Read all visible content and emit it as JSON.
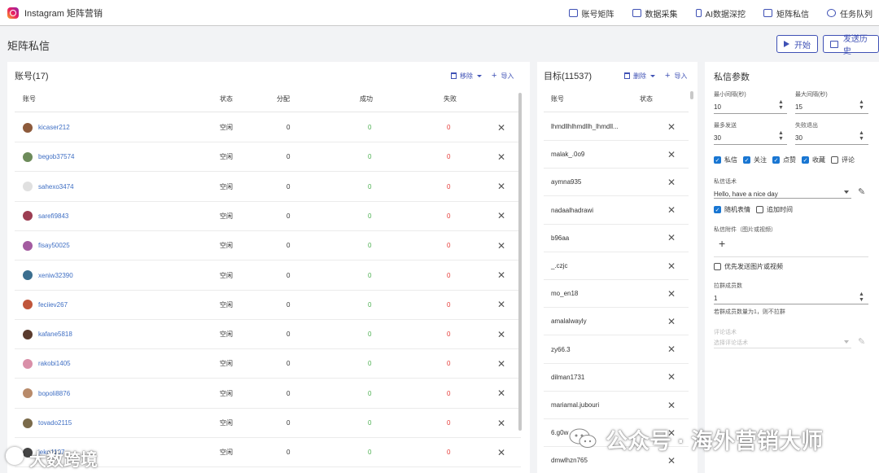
{
  "app": {
    "title": "Instagram 矩阵营销"
  },
  "nav": [
    {
      "label": "账号矩阵",
      "icon": "account-matrix-icon"
    },
    {
      "label": "数据采集",
      "icon": "data-collect-icon"
    },
    {
      "label": "AI数据深挖",
      "icon": "ai-dig-icon"
    },
    {
      "label": "矩阵私信",
      "icon": "dm-icon"
    },
    {
      "label": "任务队列",
      "icon": "task-queue-icon"
    }
  ],
  "page": {
    "title": "矩阵私信",
    "start_label": "开始",
    "history_label": "发送历史"
  },
  "accounts": {
    "title": "账号(17)",
    "remove_label": "移除",
    "import_label": "导入",
    "columns": [
      "账号",
      "状态",
      "分配",
      "成功",
      "失败"
    ],
    "rows": [
      {
        "name": "kicaser212",
        "status": "空闲",
        "assigned": "0",
        "success": "0",
        "fail": "0",
        "avatar": "#8d5a3b"
      },
      {
        "name": "begob37574",
        "status": "空闲",
        "assigned": "0",
        "success": "0",
        "fail": "0",
        "avatar": "#6d8b5a"
      },
      {
        "name": "sahexo3474",
        "status": "空闲",
        "assigned": "0",
        "success": "0",
        "fail": "0",
        "avatar": "#e0e0e0"
      },
      {
        "name": "sarefi9843",
        "status": "空闲",
        "assigned": "0",
        "success": "0",
        "fail": "0",
        "avatar": "#9c3d52"
      },
      {
        "name": "fisay50025",
        "status": "空闲",
        "assigned": "0",
        "success": "0",
        "fail": "0",
        "avatar": "#a35ba0"
      },
      {
        "name": "xeniw32390",
        "status": "空闲",
        "assigned": "0",
        "success": "0",
        "fail": "0",
        "avatar": "#3b6e8f"
      },
      {
        "name": "feciiev267",
        "status": "空闲",
        "assigned": "0",
        "success": "0",
        "fail": "0",
        "avatar": "#c0553a"
      },
      {
        "name": "kafane5818",
        "status": "空闲",
        "assigned": "0",
        "success": "0",
        "fail": "0",
        "avatar": "#5a3b2e"
      },
      {
        "name": "rakobi1405",
        "status": "空闲",
        "assigned": "0",
        "success": "0",
        "fail": "0",
        "avatar": "#d98fa8"
      },
      {
        "name": "bopoli8876",
        "status": "空闲",
        "assigned": "0",
        "success": "0",
        "fail": "0",
        "avatar": "#b88a6a"
      },
      {
        "name": "tovado2115",
        "status": "空闲",
        "assigned": "0",
        "success": "0",
        "fail": "0",
        "avatar": "#7a6a4a"
      },
      {
        "name": "jeko4107",
        "status": "空闲",
        "assigned": "0",
        "success": "0",
        "fail": "0",
        "avatar": "#444444"
      }
    ]
  },
  "targets": {
    "title": "目标(11537)",
    "delete_label": "删除",
    "import_label": "导入",
    "columns": [
      "账号",
      "状态"
    ],
    "rows": [
      "lhmdllhlhmdllh_lhmdll...",
      "malak_.0o9",
      "aymna935",
      "nadaalhadrawi",
      "b96aa",
      "_.czjc",
      "mo_en18",
      "amalalwayly",
      "zy66.3",
      "dilman1731",
      "mariamal.jubouri",
      "6.g0w",
      "dmwlhzn765"
    ]
  },
  "params": {
    "title": "私信参数",
    "min_interval_label": "最小间隔(秒)",
    "min_interval": "10",
    "max_interval_label": "最大间隔(秒)",
    "max_interval": "15",
    "max_send_label": "最多发送",
    "max_send": "30",
    "fail_exit_label": "失败退出",
    "fail_exit": "30",
    "actions": [
      {
        "label": "私信",
        "checked": true
      },
      {
        "label": "关注",
        "checked": true
      },
      {
        "label": "点赞",
        "checked": true
      },
      {
        "label": "收藏",
        "checked": true
      },
      {
        "label": "评论",
        "checked": false
      }
    ],
    "script_label": "私信话术",
    "script_value": "Hello, have a nice day",
    "options": [
      {
        "label": "随机表情",
        "checked": true
      },
      {
        "label": "追加时间",
        "checked": false
      }
    ],
    "attach_label": "私信附件（图片或视频）",
    "prefer_media_label": "优先发送图片或视频",
    "group_label": "拉群成员数",
    "group_value": "1",
    "group_hint": "若群成员数量为1，则不拉群",
    "comment_label": "评论话术",
    "comment_placeholder": "选择评论话术"
  },
  "watermarks": {
    "left": "大数跨境",
    "right": "公众号 · 海外营销大师"
  }
}
